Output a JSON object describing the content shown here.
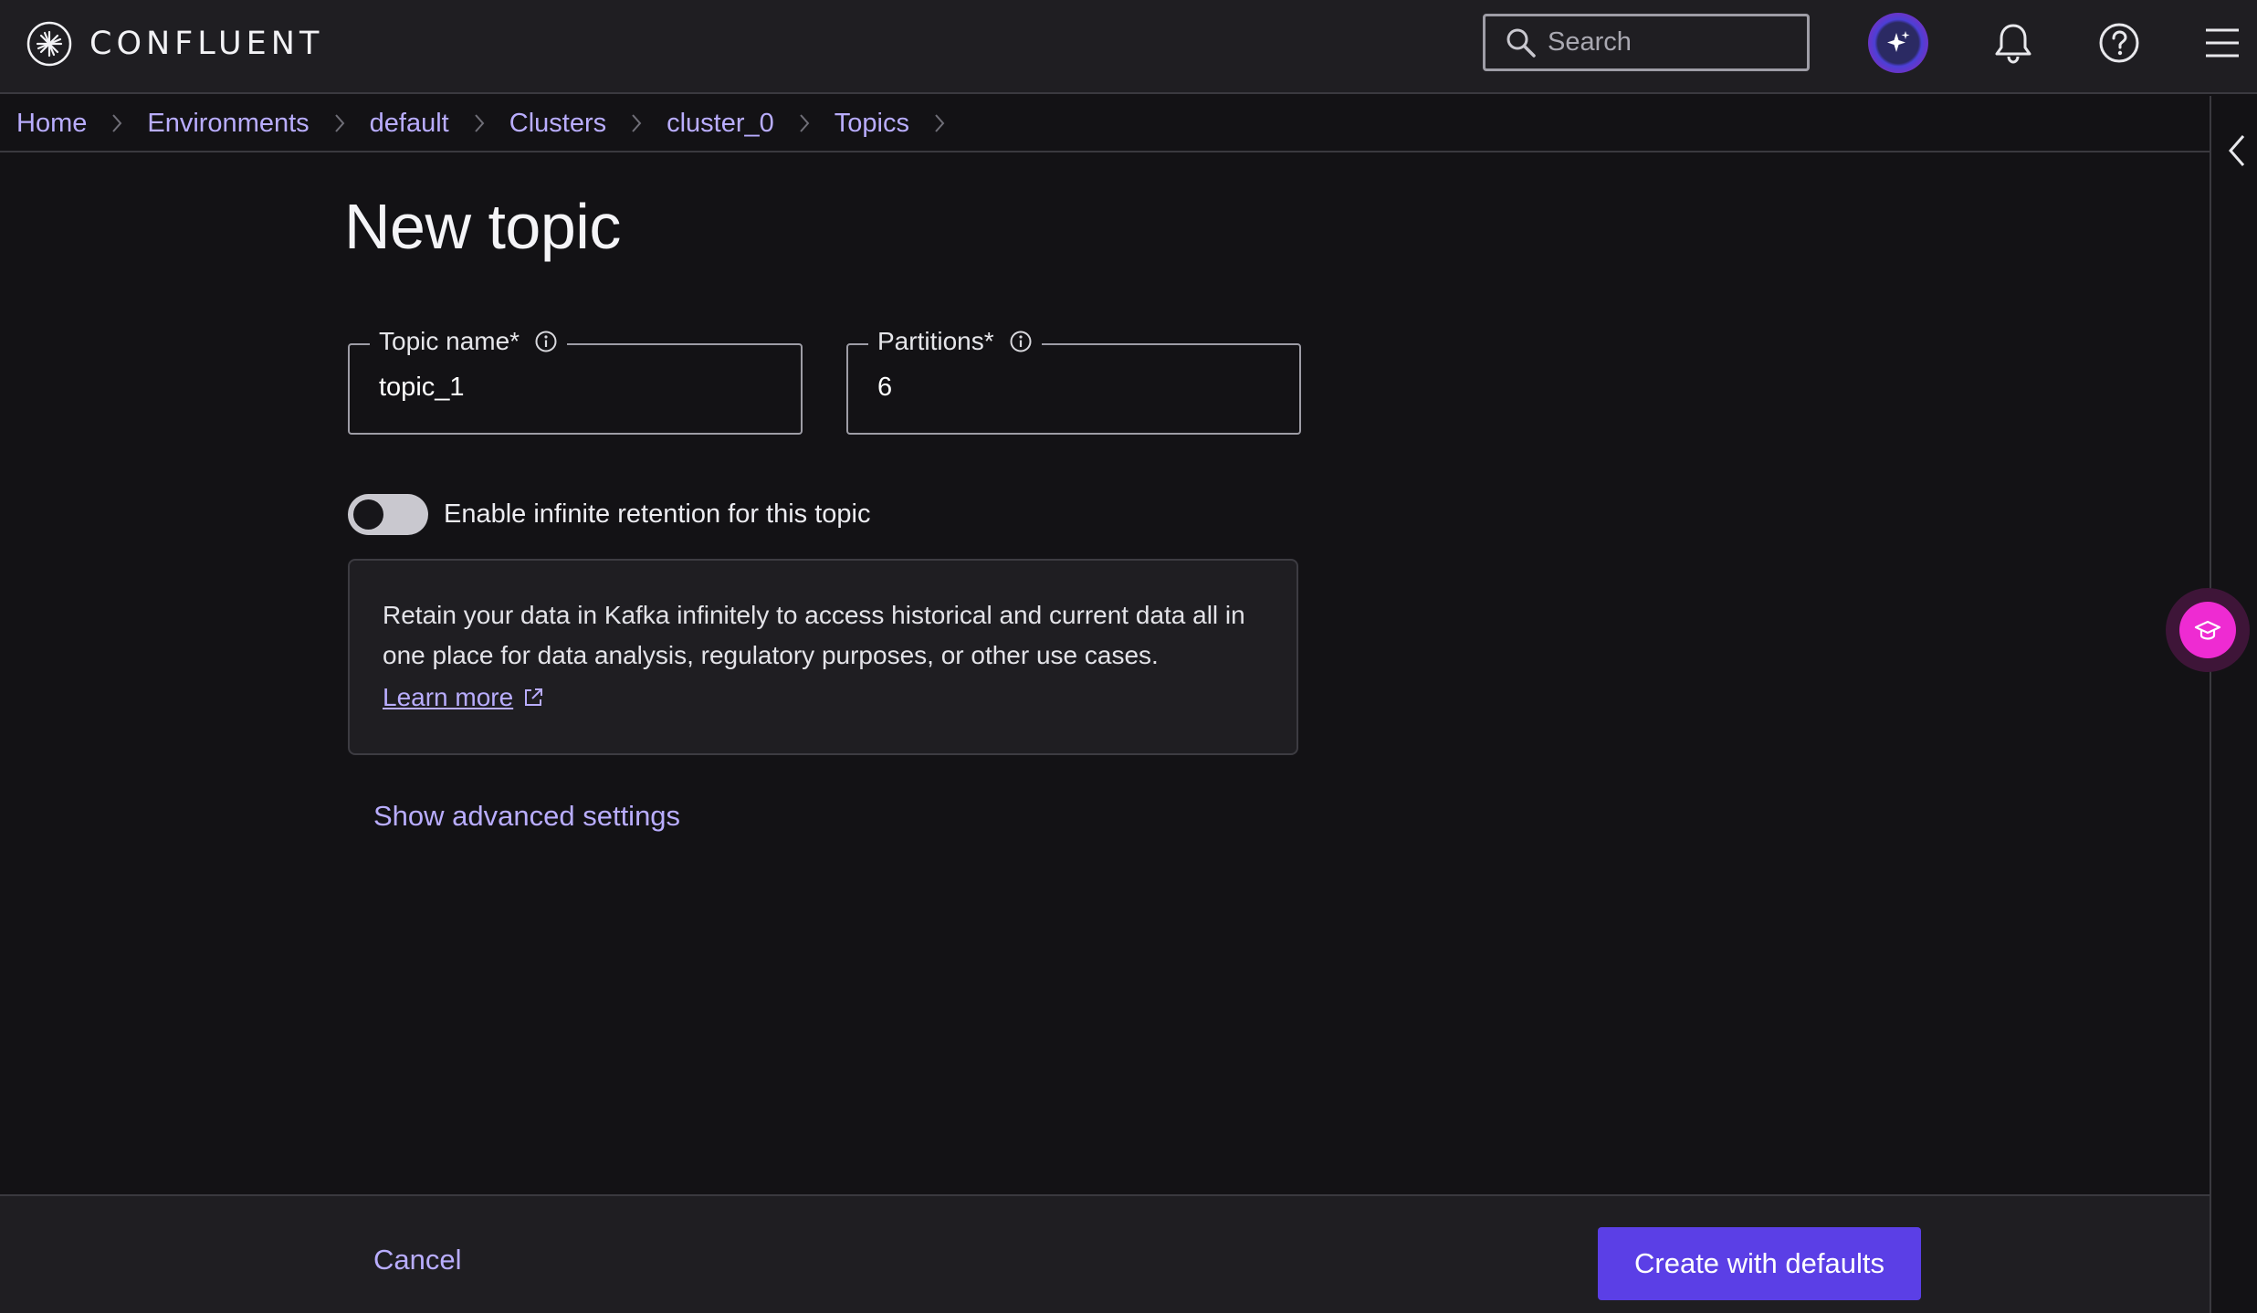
{
  "header": {
    "logo_text": "CONFLUENT",
    "search": {
      "placeholder": "Search",
      "value": ""
    },
    "icons": [
      "ai-assistant-icon",
      "bell-icon",
      "help-icon",
      "menu-icon"
    ]
  },
  "breadcrumb": [
    "Home",
    "Environments",
    "default",
    "Clusters",
    "cluster_0",
    "Topics"
  ],
  "page": {
    "title": "New topic",
    "topic_name": {
      "label": "Topic name*",
      "value": "topic_1"
    },
    "partitions": {
      "label": "Partitions*",
      "value": "6"
    },
    "retention_toggle": {
      "label": "Enable infinite retention for this topic",
      "enabled": false
    },
    "info": {
      "text": "Retain your data in Kafka infinitely to access historical and current data all in one place for data analysis, regulatory purposes, or other use cases.",
      "link": "Learn more"
    },
    "advanced_link": "Show advanced settings"
  },
  "footer": {
    "cancel": "Cancel",
    "create": "Create with defaults"
  },
  "colors": {
    "background": "#131215",
    "surface": "#1f1e22",
    "link": "#b9adff",
    "primary": "#5b3fe6",
    "learn_accent": "#ee2bd2"
  }
}
